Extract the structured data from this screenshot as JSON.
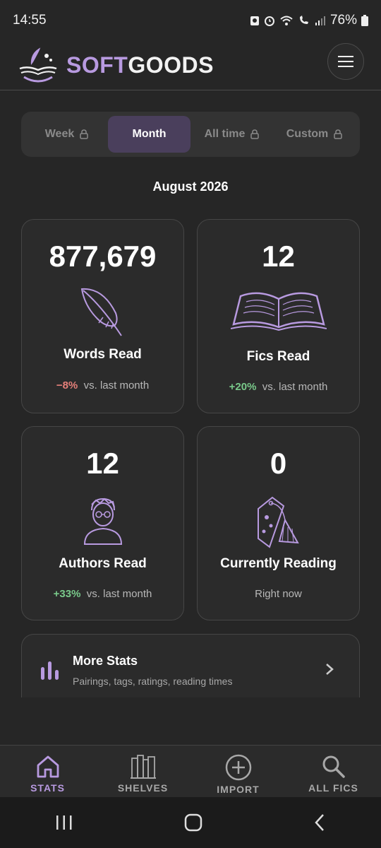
{
  "status_bar": {
    "time": "14:55",
    "battery": "76%"
  },
  "header": {
    "brand_soft": "SOFT",
    "brand_goods": "GOODS",
    "menu_icon": "hamburger-icon"
  },
  "tabs": [
    {
      "label": "Week",
      "locked": true,
      "active": false
    },
    {
      "label": "Month",
      "locked": false,
      "active": true
    },
    {
      "label": "All time",
      "locked": true,
      "active": false
    },
    {
      "label": "Custom",
      "locked": true,
      "active": false
    }
  ],
  "period": "August 2026",
  "cards": {
    "words": {
      "value": "877,679",
      "label": "Words Read",
      "change": "−8%",
      "change_text": "vs. last month",
      "icon": "feather-icon"
    },
    "fics": {
      "value": "12",
      "label": "Fics Read",
      "change": "+20%",
      "change_text": "vs. last month",
      "icon": "open-book-icon"
    },
    "authors": {
      "value": "12",
      "label": "Authors Read",
      "change": "+33%",
      "change_text": "vs. last month",
      "icon": "author-avatar-icon"
    },
    "reading": {
      "value": "0",
      "label": "Currently Reading",
      "sub": "Right now",
      "icon": "bookmark-icon"
    }
  },
  "more_stats": {
    "title": "More Stats",
    "desc": "Pairings, tags, ratings, reading times"
  },
  "nav": [
    {
      "label": "STATS",
      "icon": "home-icon",
      "active": true
    },
    {
      "label": "SHELVES",
      "icon": "bookshelf-icon",
      "active": false
    },
    {
      "label": "IMPORT",
      "icon": "plus-circle-icon",
      "active": false
    },
    {
      "label": "ALL FICS",
      "icon": "search-icon",
      "active": false
    }
  ],
  "colors": {
    "accent": "#b89ae0",
    "background": "#262626",
    "card": "#2b2b2b",
    "negative": "#e6807a",
    "positive": "#79c98a"
  }
}
